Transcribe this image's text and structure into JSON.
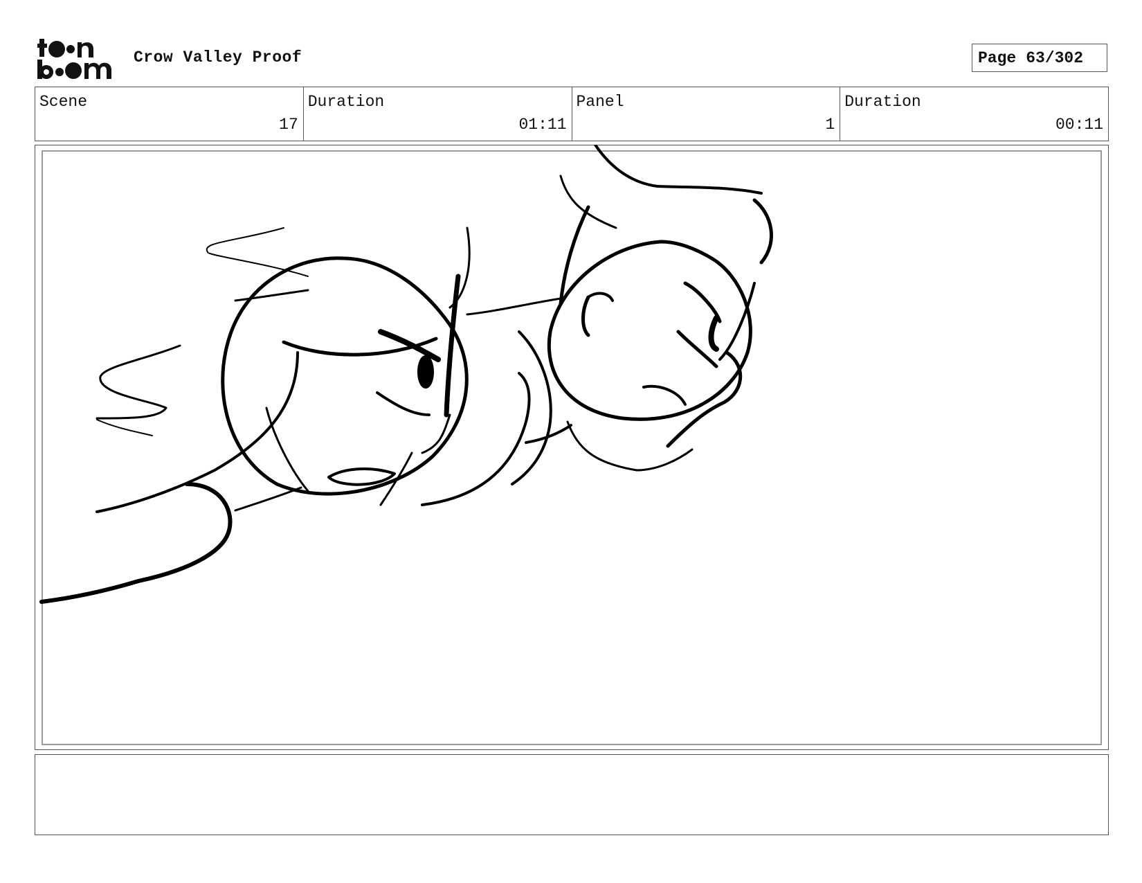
{
  "header": {
    "logo_text": "toon boom",
    "project_title": "Crow Valley Proof",
    "page_label": "Page",
    "page_number": "63/302"
  },
  "info": {
    "scene_label": "Scene",
    "scene_value": "17",
    "scene_duration_label": "Duration",
    "scene_duration_value": "01:11",
    "panel_label": "Panel",
    "panel_value": "1",
    "panel_duration_label": "Duration",
    "panel_duration_value": "00:11"
  },
  "notes": {
    "text": ""
  }
}
